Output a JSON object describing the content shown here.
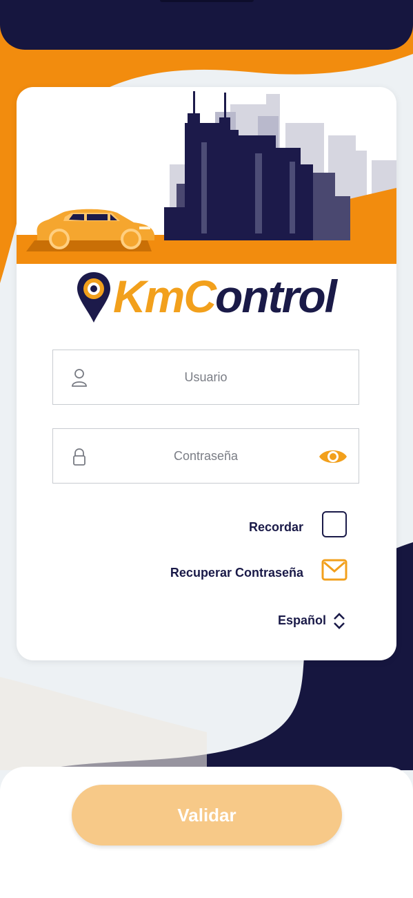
{
  "app": {
    "brand": "KmControl",
    "brand_parts": [
      "Km",
      "C",
      "ontrol"
    ]
  },
  "form": {
    "username_placeholder": "Usuario",
    "password_placeholder": "Contraseña",
    "remember_label": "Recordar",
    "remember_checked": false,
    "recover_label": "Recuperar Contraseña",
    "language_label": "Español"
  },
  "actions": {
    "validate_label": "Validar"
  },
  "icons": {
    "username": "user-icon",
    "password": "lock-icon",
    "show_password": "eye-icon",
    "recover": "mail-icon",
    "language": "chevron-up-down-icon",
    "logo": "location-pin-icon"
  },
  "colors": {
    "navy": "#16163f",
    "orange": "#f28c0e",
    "button": "#f7c988",
    "white": "#ffffff"
  }
}
